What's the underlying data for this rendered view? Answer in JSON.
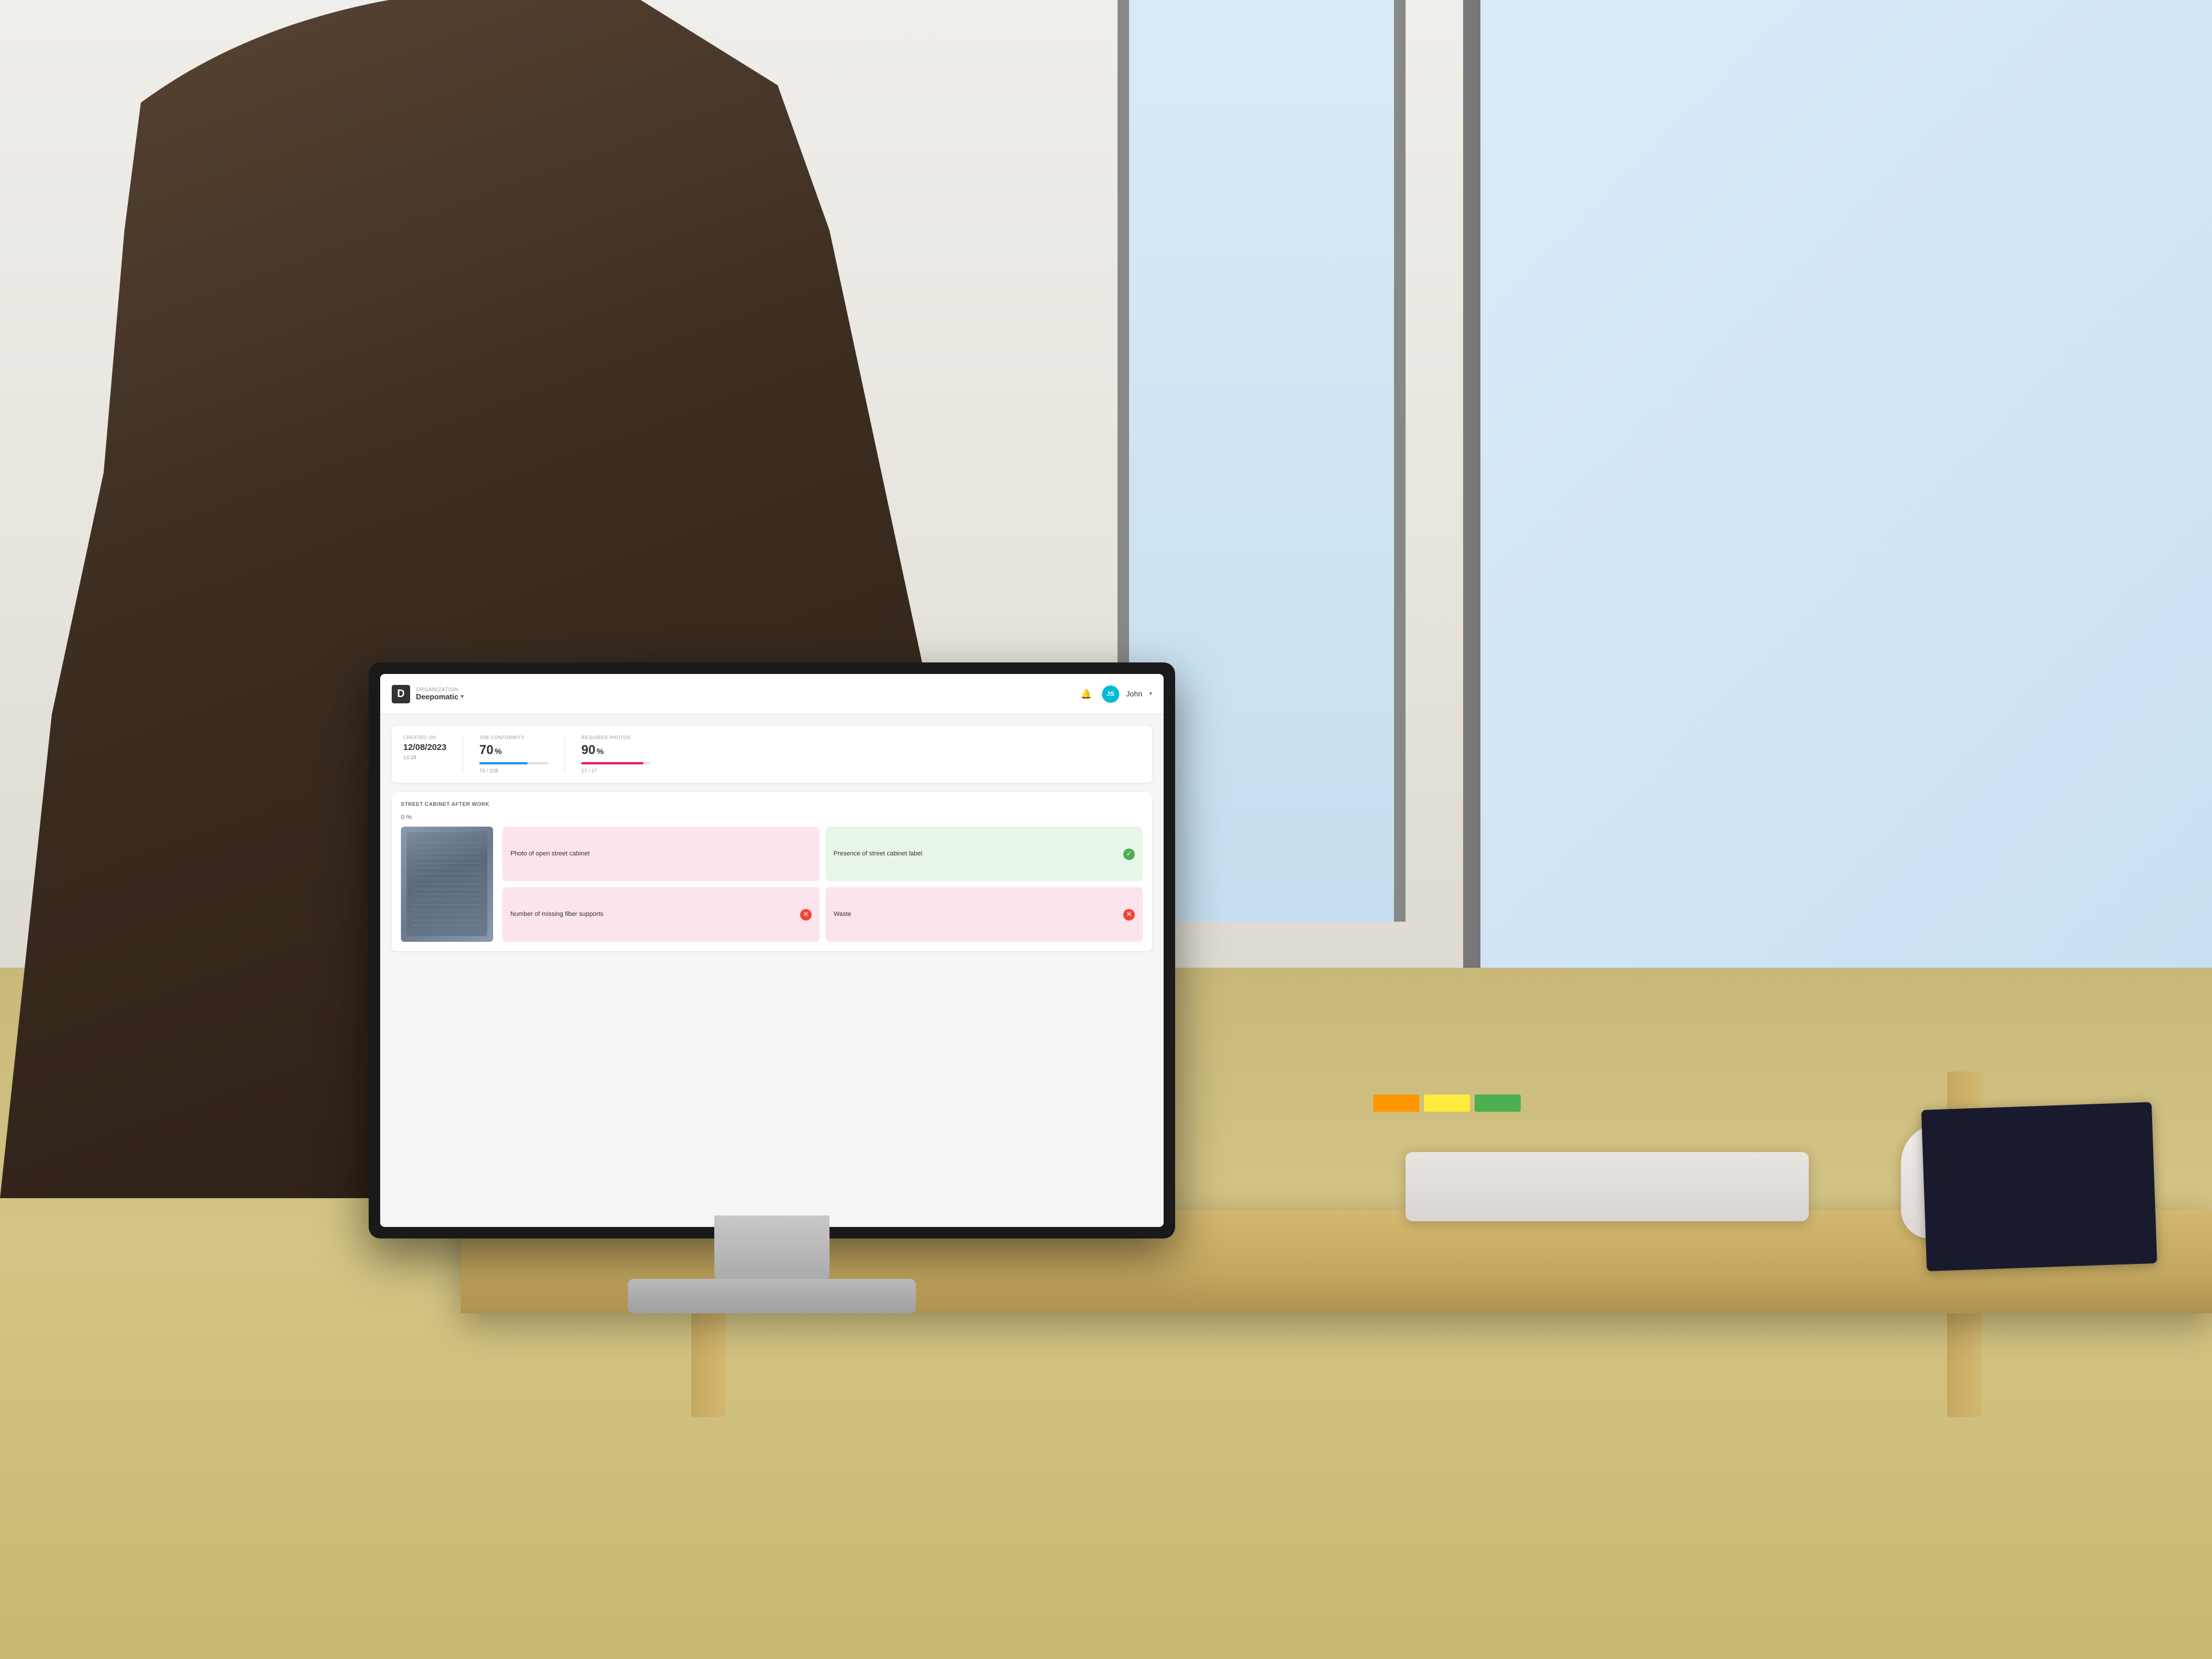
{
  "scene": {
    "background_color": "#d0cfc8"
  },
  "app": {
    "organization": {
      "label": "ORGANIZATION",
      "name": "Deepomatic",
      "dropdown_icon": "▾"
    },
    "header": {
      "notification_icon": "🔔",
      "user_initials": "JS",
      "user_name": "John",
      "user_dropdown": "▾"
    },
    "stats": {
      "created_on_label": "CREATED ON",
      "created_on_value": "12/08/2023",
      "created_on_sub": "14:28",
      "job_conformity_label": "JOB CONFORMITY",
      "job_conformity_value": "70",
      "job_conformity_unit": "%",
      "job_conformity_fraction": "76 / 108",
      "job_conformity_progress": 70,
      "required_photos_label": "REQUIRED PHOTOS",
      "required_photos_value": "90",
      "required_photos_unit": "%",
      "required_photos_fraction": "17 / 17",
      "required_photos_progress": 90,
      "zero_percent": "0 %"
    },
    "section": {
      "title": "STREET CABINET AFTER WORK"
    },
    "cards": [
      {
        "label": "Photo of open street cabinet",
        "status": "neutral",
        "icon": null
      },
      {
        "label": "Presence of street cabinet label",
        "status": "success",
        "icon": "✓"
      },
      {
        "label": "Number of missing fiber supports",
        "status": "error",
        "icon": "✕"
      },
      {
        "label": "Waste",
        "status": "error",
        "icon": "✕"
      }
    ]
  }
}
